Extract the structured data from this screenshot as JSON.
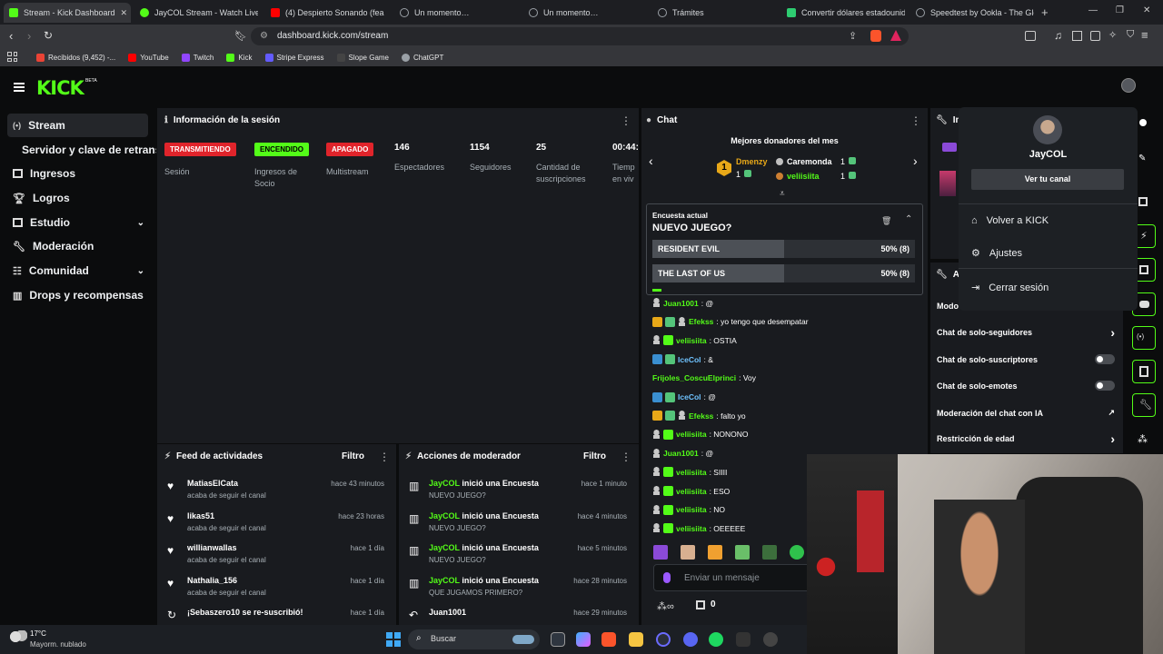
{
  "browser": {
    "tabs": [
      {
        "title": "Stream - Kick Dashboard",
        "color": "#53fc18"
      },
      {
        "title": "JayCOL Stream - Watch Live on",
        "color": "#53fc18"
      },
      {
        "title": "(4) Despierto Sonando (fea",
        "color": "#ff0000"
      },
      {
        "title": "Un momento…",
        "color": "#9aa0a6"
      },
      {
        "title": "Un momento…",
        "color": "#9aa0a6"
      },
      {
        "title": "Trámites",
        "color": "#9aa0a6"
      },
      {
        "title": "Convertir dólares estadounide",
        "color": "#2ecc71"
      },
      {
        "title": "Speedtest by Ookla - The Glob",
        "color": "#9aa0a6"
      }
    ],
    "url": "dashboard.kick.com/stream",
    "bookmarks": [
      {
        "label": "Recibidos (9,452) -...",
        "color": "#ea4335"
      },
      {
        "label": "YouTube",
        "color": "#ff0000"
      },
      {
        "label": "Twitch",
        "color": "#9146ff"
      },
      {
        "label": "Kick",
        "color": "#53fc18"
      },
      {
        "label": "Stripe Express",
        "color": "#635bff"
      },
      {
        "label": "Slope Game",
        "color": "#2b2b2b"
      },
      {
        "label": "ChatGPT",
        "color": "#9aa0a6"
      }
    ]
  },
  "app": {
    "logo": "KICK",
    "logo_sup": "BETA",
    "sidebar": [
      {
        "label": "Stream",
        "active": true
      },
      {
        "label": "Servidor y clave de retransm"
      },
      {
        "label": "Ingresos"
      },
      {
        "label": "Logros"
      },
      {
        "label": "Estudio"
      },
      {
        "label": "Moderación"
      },
      {
        "label": "Comunidad"
      },
      {
        "label": "Drops y recompensas"
      }
    ],
    "session": {
      "title": "Información de la sesión",
      "badges": [
        {
          "text": "TRANSMITIENDO",
          "label": "Sesión",
          "bg": "#e0242b",
          "fg": "#ffffff"
        },
        {
          "text": "ENCENDIDO",
          "label": "Ingresos de Socio",
          "bg": "#53fc18",
          "fg": "#000000"
        },
        {
          "text": "APAGADO",
          "label": "Multistream",
          "bg": "#e0242b",
          "fg": "#ffffff"
        }
      ],
      "stats": [
        {
          "value": "146",
          "label": "Espectadores"
        },
        {
          "value": "1154",
          "label": "Seguidores"
        },
        {
          "value": "25",
          "label": "Cantidad de suscripciones"
        },
        {
          "value": "00:44:",
          "label": "Tiemp en viv"
        }
      ]
    },
    "activity": {
      "title": "Feed de actividades",
      "filter": "Filtro",
      "items": [
        {
          "name": "MatiasElCata",
          "sub": "acaba de seguir el canal",
          "time": "hace 43 minutos"
        },
        {
          "name": "likas51",
          "sub": "acaba de seguir el canal",
          "time": "hace 23 horas"
        },
        {
          "name": "willianwallas",
          "sub": "acaba de seguir el canal",
          "time": "hace 1 día"
        },
        {
          "name": "Nathalia_156",
          "sub": "acaba de seguir el canal",
          "time": "hace 1 día"
        },
        {
          "name": "¡Sebaszero10 se re-suscribió!",
          "sub": "",
          "time": "hace 1 día"
        }
      ]
    },
    "modactions": {
      "title": "Acciones de moderador",
      "filter": "Filtro",
      "items": [
        {
          "user": "JayCOL",
          "action": "inició una Encuesta",
          "sub": "NUEVO JUEGO?",
          "time": "hace 1 minuto"
        },
        {
          "user": "JayCOL",
          "action": "inició una Encuesta",
          "sub": "NUEVO JUEGO?",
          "time": "hace 4 minutos"
        },
        {
          "user": "JayCOL",
          "action": "inició una Encuesta",
          "sub": "NUEVO JUEGO?",
          "time": "hace 5 minutos"
        },
        {
          "user": "JayCOL",
          "action": "inició una Encuesta",
          "sub": "QUE JUGAMOS PRIMERO?",
          "time": "hace 28 minutos"
        },
        {
          "user": "Juan1001",
          "action": "",
          "sub": "",
          "time": "hace 29 minutos"
        }
      ]
    },
    "chat": {
      "title": "Chat",
      "donors_title": "Mejores donadores del mes",
      "donors": [
        {
          "rank": "1",
          "name": "Dmenzy",
          "count": "1"
        },
        {
          "rank": "2",
          "name": "Caremonda",
          "count": "1"
        },
        {
          "rank": "3",
          "name": "veliisiita",
          "count": "1"
        }
      ],
      "poll": {
        "label": "Encuesta actual",
        "question": "NUEVO JUEGO?",
        "options": [
          {
            "text": "RESIDENT EVIL",
            "pct": "50% (8)",
            "fill": 0.5
          },
          {
            "text": "THE LAST OF US",
            "pct": "50% (8)",
            "fill": 0.5
          }
        ]
      },
      "messages": [
        {
          "user": "Juan1001",
          "text": ": @",
          "color": "#53fc18",
          "badges": [
            "pawn"
          ]
        },
        {
          "user": "Efekss",
          "text": ": yo tengo que desempatar",
          "color": "#53fc18",
          "badges": [
            "crown",
            "sub",
            "pawn"
          ]
        },
        {
          "user": "veliisiita",
          "text": ": OSTIA",
          "color": "#53fc18",
          "badges": [
            "pawn",
            "grn"
          ]
        },
        {
          "user": "IceCol",
          "text": ": &",
          "color": "#6fc3ff",
          "badges": [
            "blue",
            "sub"
          ]
        },
        {
          "user": "Frijoles_CoscuElprinci",
          "text": ": Voy",
          "color": "#53fc18",
          "badges": []
        },
        {
          "user": "IceCol",
          "text": ": @",
          "color": "#6fc3ff",
          "badges": [
            "blue",
            "sub"
          ]
        },
        {
          "user": "Efekss",
          "text": ": falto yo",
          "color": "#53fc18",
          "badges": [
            "crown",
            "sub",
            "pawn"
          ]
        },
        {
          "user": "veliisiita",
          "text": ": NONONO",
          "color": "#53fc18",
          "badges": [
            "pawn",
            "grn"
          ]
        },
        {
          "user": "Juan1001",
          "text": ": @",
          "color": "#53fc18",
          "badges": [
            "pawn"
          ]
        },
        {
          "user": "veliisiita",
          "text": ": SIIII",
          "color": "#53fc18",
          "badges": [
            "pawn",
            "grn"
          ]
        },
        {
          "user": "veliisiita",
          "text": ": ESO",
          "color": "#53fc18",
          "badges": [
            "pawn",
            "grn"
          ]
        },
        {
          "user": "veliisiita",
          "text": ": NO",
          "color": "#53fc18",
          "badges": [
            "pawn",
            "grn"
          ]
        },
        {
          "user": "veliisiita",
          "text": ": OEEEEE",
          "color": "#53fc18",
          "badges": [
            "pawn",
            "grn"
          ]
        }
      ],
      "input_placeholder": "Enviar un mensaje",
      "points": "0"
    },
    "settings": {
      "rows": [
        {
          "label": "Modo lento",
          "control": "chevron"
        },
        {
          "label": "Chat de solo-seguidores",
          "control": "chevron"
        },
        {
          "label": "Chat de solo-suscriptores",
          "control": "toggle"
        },
        {
          "label": "Chat de solo-emotes",
          "control": "toggle"
        },
        {
          "label": "Moderación del chat con IA",
          "control": "ext"
        },
        {
          "label": "Restricción de edad",
          "control": "chevron"
        }
      ],
      "partial_titles": {
        "top": "In",
        "mid": "Ac"
      }
    },
    "usermenu": {
      "name": "JayCOL",
      "button": "Ver tu canal",
      "items": [
        "Volver a KICK",
        "Ajustes",
        "Cerrar sesión"
      ]
    }
  },
  "taskbar": {
    "weather_temp": "17°C",
    "weather_desc": "Mayorm. nublado",
    "search": "Buscar"
  }
}
